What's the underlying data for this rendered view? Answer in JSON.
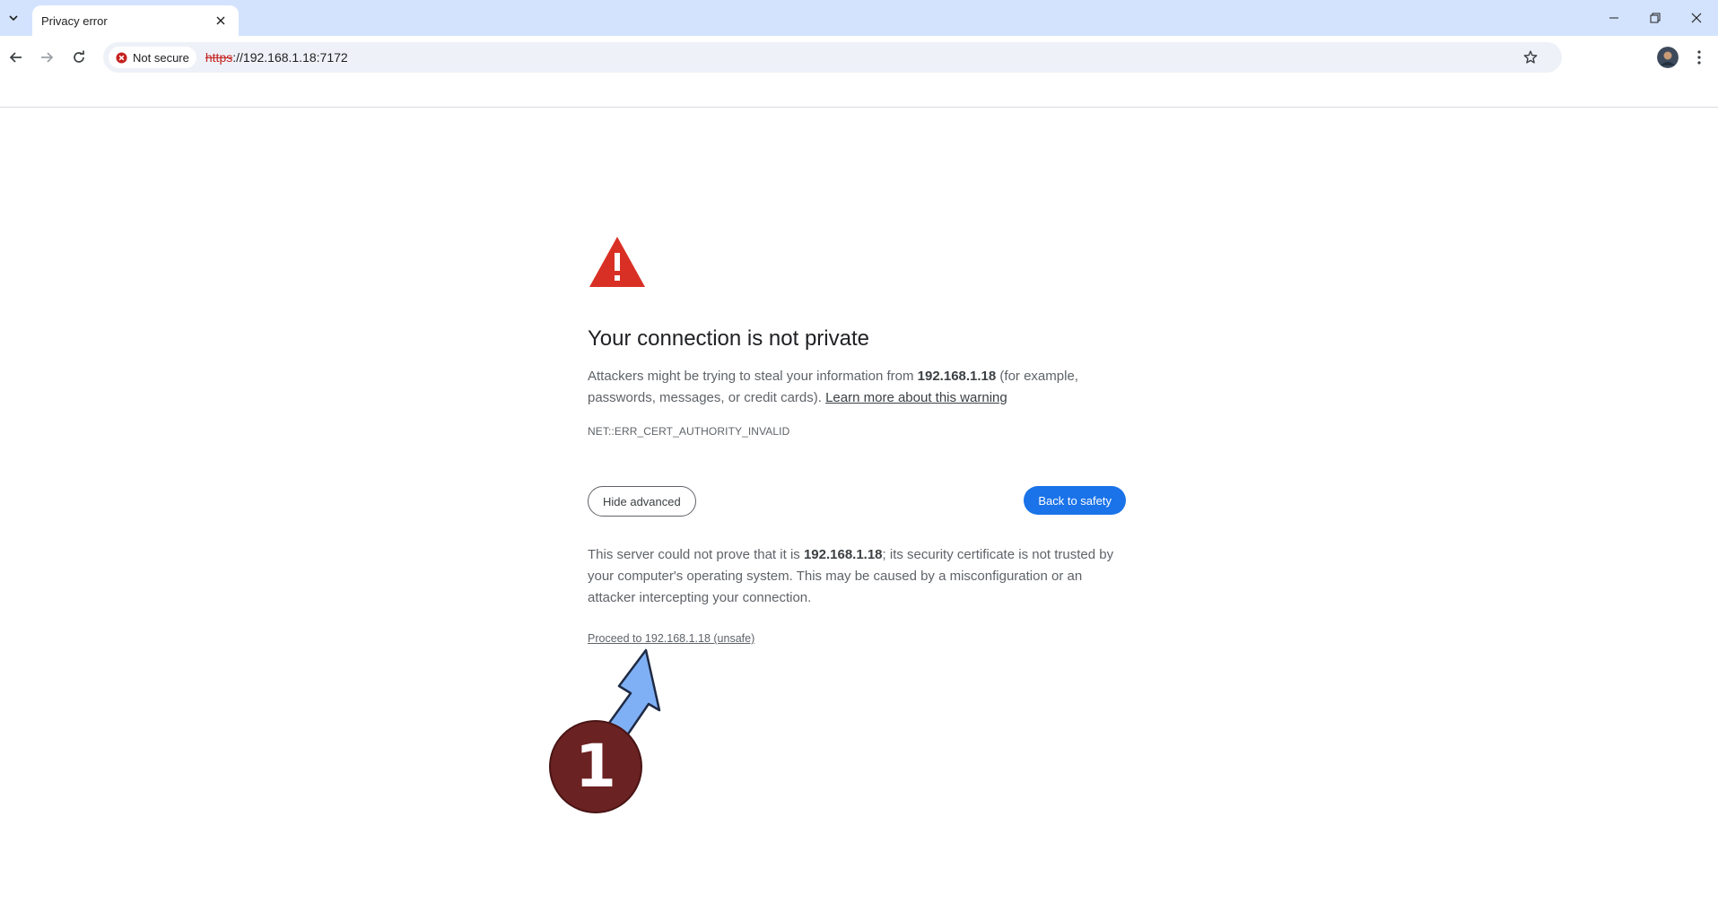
{
  "browser": {
    "tab": {
      "title": "Privacy error"
    },
    "address_bar": {
      "security_label": "Not secure",
      "url_scheme": "https",
      "url_rest": "://192.168.1.18:7172"
    },
    "icons": {
      "tab_search": "chevron-down-icon",
      "tab_close": "close-icon",
      "back": "arrow-left-icon",
      "forward": "arrow-right-icon",
      "reload": "reload-icon",
      "security": "error-circle-icon",
      "bookmark": "star-icon",
      "menu": "kebab-menu-icon"
    }
  },
  "interstitial": {
    "heading": "Your connection is not private",
    "explanation_before": "Attackers might be trying to steal your information from ",
    "explanation_host": "192.168.1.18",
    "explanation_after": " (for example, passwords, messages, or credit cards). ",
    "learn_more": "Learn more about this warning",
    "error_code": "NET::ERR_CERT_AUTHORITY_INVALID",
    "hide_advanced": "Hide advanced",
    "back_to_safety": "Back to safety",
    "details_before": "This server could not prove that it is ",
    "details_host": "192.168.1.18",
    "details_after": "; its security certificate is not trusted by your computer's operating system. This may be caused by a misconfiguration or an attacker intercepting your connection.",
    "proceed_link": "Proceed to 192.168.1.18 (unsafe)"
  },
  "annotation": {
    "step_number": "1",
    "colors": {
      "arrow": "#7fb0f5",
      "badge": "#6b2222"
    }
  },
  "colors": {
    "title_bar": "#d3e3fd",
    "primary_button": "#1a73e8",
    "warning_red": "#d93025",
    "not_secure_red": "#c5221f"
  }
}
